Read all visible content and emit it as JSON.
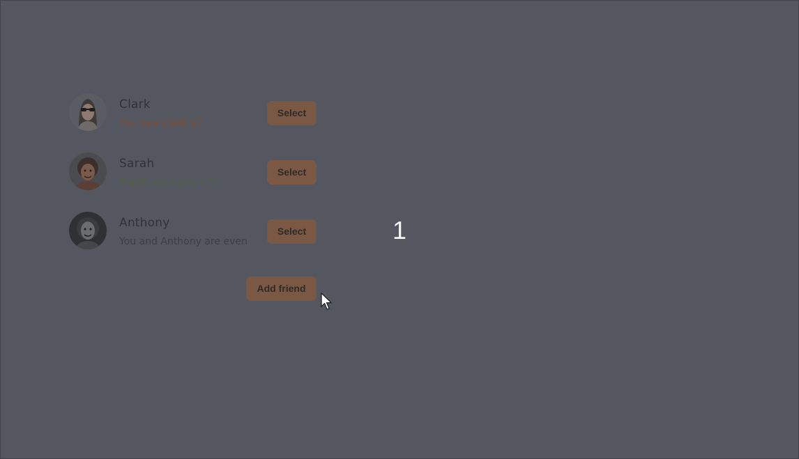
{
  "friends": [
    {
      "name": "Clark",
      "balance": "You owe Clark $7",
      "status": "owe",
      "select_label": "Select",
      "icon": "woman-sunglasses-avatar"
    },
    {
      "name": "Sarah",
      "balance": "Sarah owes you $20",
      "status": "owed",
      "select_label": "Select",
      "icon": "woman-avatar"
    },
    {
      "name": "Anthony",
      "balance": "You and Anthony are even",
      "status": "even",
      "select_label": "Select",
      "icon": "man-avatar"
    }
  ],
  "add_friend_label": "Add friend",
  "step_number": "1",
  "colors": {
    "background": "#545760",
    "button": "#7b5844",
    "owe_text": "#7a4d36",
    "owed_text": "#4d5e44",
    "even_text": "#3b3f44"
  }
}
